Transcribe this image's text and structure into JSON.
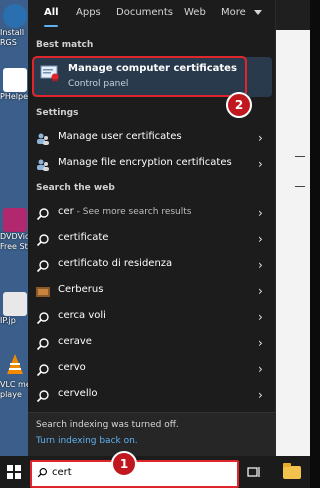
{
  "tabs": [
    "All",
    "Apps",
    "Documents",
    "Web",
    "More"
  ],
  "sections": {
    "best_match": "Best match",
    "settings": "Settings",
    "search_web": "Search the web"
  },
  "best_match": {
    "title": "Manage computer certificates",
    "subtitle": "Control panel",
    "badge": "2"
  },
  "settings_items": [
    "Manage user certificates",
    "Manage file encryption certificates"
  ],
  "web_items": [
    {
      "text": "cer",
      "hint": " - See more search results"
    },
    {
      "text": "certificate"
    },
    {
      "text": "certificato di residenza"
    },
    {
      "text": "Cerberus"
    },
    {
      "text": "cerca voli"
    },
    {
      "text": "cerave"
    },
    {
      "text": "cervo"
    },
    {
      "text": "cervello"
    }
  ],
  "notice": {
    "line1": "Search indexing was turned off.",
    "link": "Turn indexing back on."
  },
  "taskbar": {
    "search_value": "cert",
    "badge": "1"
  },
  "desktop_icons": [
    {
      "label1": "Install",
      "label2": "RGS"
    },
    {
      "label1": "PHelpe",
      "label2": ""
    },
    {
      "label1": "DVDVide",
      "label2": "Free Stu"
    },
    {
      "label1": "IP.jp",
      "label2": ""
    },
    {
      "label1": "VLC me",
      "label2": "playe"
    }
  ],
  "colors": {
    "accent": "#5fb2f2",
    "highlight_red": "#e0262b",
    "panel_bg": "#1c1c1c"
  }
}
